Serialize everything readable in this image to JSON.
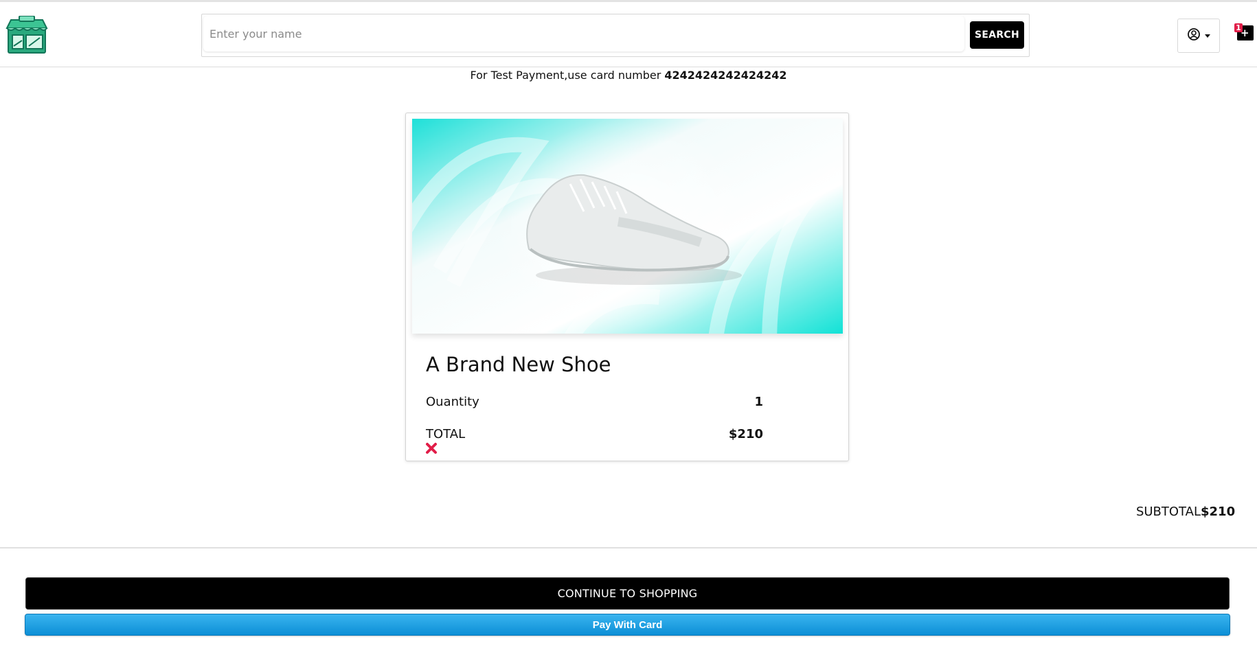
{
  "header": {
    "logo_icon": "store-icon",
    "search": {
      "placeholder": "Enter your name",
      "value": ""
    },
    "search_button_label": "SEARCH",
    "account_icon": "user-circle-icon",
    "cart": {
      "icon": "shopping-bag-icon",
      "count": "1"
    }
  },
  "notice": {
    "prefix": "For Test Payment,use card number ",
    "card_number": "4242424242424242"
  },
  "cart_item": {
    "image_icon": "shoe-image",
    "title": "A Brand New Shoe",
    "quantity_label": "Ouantity",
    "quantity_value": "1",
    "total_label": "TOTAL",
    "total_value": "$210",
    "remove_icon": "close-icon",
    "remove_color": "#e11d48"
  },
  "summary": {
    "subtotal_label": "SUBTOTAL",
    "subtotal_value": "$210"
  },
  "actions": {
    "continue_label": "CONTINUE TO SHOPPING",
    "pay_label": "Pay With Card"
  },
  "colors": {
    "primary": "#000000",
    "pay_button": "#1ba1e2",
    "accent_teal": "#1fd8d0",
    "badge": "#e11d48"
  }
}
